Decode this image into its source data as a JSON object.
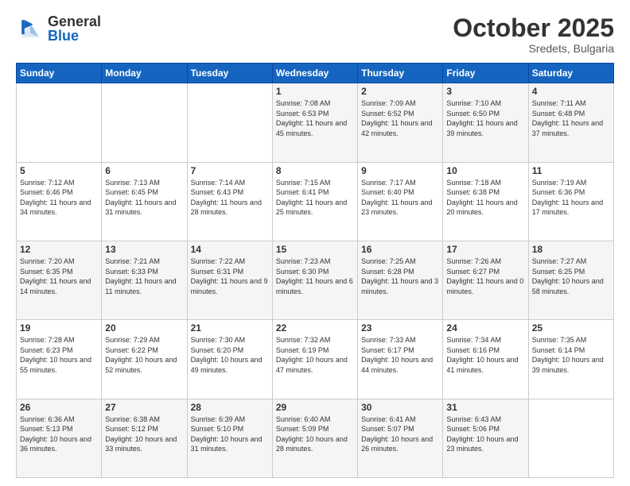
{
  "header": {
    "logo_general": "General",
    "logo_blue": "Blue",
    "month_title": "October 2025",
    "location": "Sredets, Bulgaria"
  },
  "days_of_week": [
    "Sunday",
    "Monday",
    "Tuesday",
    "Wednesday",
    "Thursday",
    "Friday",
    "Saturday"
  ],
  "weeks": [
    [
      {
        "day": "",
        "info": ""
      },
      {
        "day": "",
        "info": ""
      },
      {
        "day": "",
        "info": ""
      },
      {
        "day": "1",
        "info": "Sunrise: 7:08 AM\nSunset: 6:53 PM\nDaylight: 11 hours and 45 minutes."
      },
      {
        "day": "2",
        "info": "Sunrise: 7:09 AM\nSunset: 6:52 PM\nDaylight: 11 hours and 42 minutes."
      },
      {
        "day": "3",
        "info": "Sunrise: 7:10 AM\nSunset: 6:50 PM\nDaylight: 11 hours and 39 minutes."
      },
      {
        "day": "4",
        "info": "Sunrise: 7:11 AM\nSunset: 6:48 PM\nDaylight: 11 hours and 37 minutes."
      }
    ],
    [
      {
        "day": "5",
        "info": "Sunrise: 7:12 AM\nSunset: 6:46 PM\nDaylight: 11 hours and 34 minutes."
      },
      {
        "day": "6",
        "info": "Sunrise: 7:13 AM\nSunset: 6:45 PM\nDaylight: 11 hours and 31 minutes."
      },
      {
        "day": "7",
        "info": "Sunrise: 7:14 AM\nSunset: 6:43 PM\nDaylight: 11 hours and 28 minutes."
      },
      {
        "day": "8",
        "info": "Sunrise: 7:15 AM\nSunset: 6:41 PM\nDaylight: 11 hours and 25 minutes."
      },
      {
        "day": "9",
        "info": "Sunrise: 7:17 AM\nSunset: 6:40 PM\nDaylight: 11 hours and 23 minutes."
      },
      {
        "day": "10",
        "info": "Sunrise: 7:18 AM\nSunset: 6:38 PM\nDaylight: 11 hours and 20 minutes."
      },
      {
        "day": "11",
        "info": "Sunrise: 7:19 AM\nSunset: 6:36 PM\nDaylight: 11 hours and 17 minutes."
      }
    ],
    [
      {
        "day": "12",
        "info": "Sunrise: 7:20 AM\nSunset: 6:35 PM\nDaylight: 11 hours and 14 minutes."
      },
      {
        "day": "13",
        "info": "Sunrise: 7:21 AM\nSunset: 6:33 PM\nDaylight: 11 hours and 11 minutes."
      },
      {
        "day": "14",
        "info": "Sunrise: 7:22 AM\nSunset: 6:31 PM\nDaylight: 11 hours and 9 minutes."
      },
      {
        "day": "15",
        "info": "Sunrise: 7:23 AM\nSunset: 6:30 PM\nDaylight: 11 hours and 6 minutes."
      },
      {
        "day": "16",
        "info": "Sunrise: 7:25 AM\nSunset: 6:28 PM\nDaylight: 11 hours and 3 minutes."
      },
      {
        "day": "17",
        "info": "Sunrise: 7:26 AM\nSunset: 6:27 PM\nDaylight: 11 hours and 0 minutes."
      },
      {
        "day": "18",
        "info": "Sunrise: 7:27 AM\nSunset: 6:25 PM\nDaylight: 10 hours and 58 minutes."
      }
    ],
    [
      {
        "day": "19",
        "info": "Sunrise: 7:28 AM\nSunset: 6:23 PM\nDaylight: 10 hours and 55 minutes."
      },
      {
        "day": "20",
        "info": "Sunrise: 7:29 AM\nSunset: 6:22 PM\nDaylight: 10 hours and 52 minutes."
      },
      {
        "day": "21",
        "info": "Sunrise: 7:30 AM\nSunset: 6:20 PM\nDaylight: 10 hours and 49 minutes."
      },
      {
        "day": "22",
        "info": "Sunrise: 7:32 AM\nSunset: 6:19 PM\nDaylight: 10 hours and 47 minutes."
      },
      {
        "day": "23",
        "info": "Sunrise: 7:33 AM\nSunset: 6:17 PM\nDaylight: 10 hours and 44 minutes."
      },
      {
        "day": "24",
        "info": "Sunrise: 7:34 AM\nSunset: 6:16 PM\nDaylight: 10 hours and 41 minutes."
      },
      {
        "day": "25",
        "info": "Sunrise: 7:35 AM\nSunset: 6:14 PM\nDaylight: 10 hours and 39 minutes."
      }
    ],
    [
      {
        "day": "26",
        "info": "Sunrise: 6:36 AM\nSunset: 5:13 PM\nDaylight: 10 hours and 36 minutes."
      },
      {
        "day": "27",
        "info": "Sunrise: 6:38 AM\nSunset: 5:12 PM\nDaylight: 10 hours and 33 minutes."
      },
      {
        "day": "28",
        "info": "Sunrise: 6:39 AM\nSunset: 5:10 PM\nDaylight: 10 hours and 31 minutes."
      },
      {
        "day": "29",
        "info": "Sunrise: 6:40 AM\nSunset: 5:09 PM\nDaylight: 10 hours and 28 minutes."
      },
      {
        "day": "30",
        "info": "Sunrise: 6:41 AM\nSunset: 5:07 PM\nDaylight: 10 hours and 26 minutes."
      },
      {
        "day": "31",
        "info": "Sunrise: 6:43 AM\nSunset: 5:06 PM\nDaylight: 10 hours and 23 minutes."
      },
      {
        "day": "",
        "info": ""
      }
    ]
  ]
}
